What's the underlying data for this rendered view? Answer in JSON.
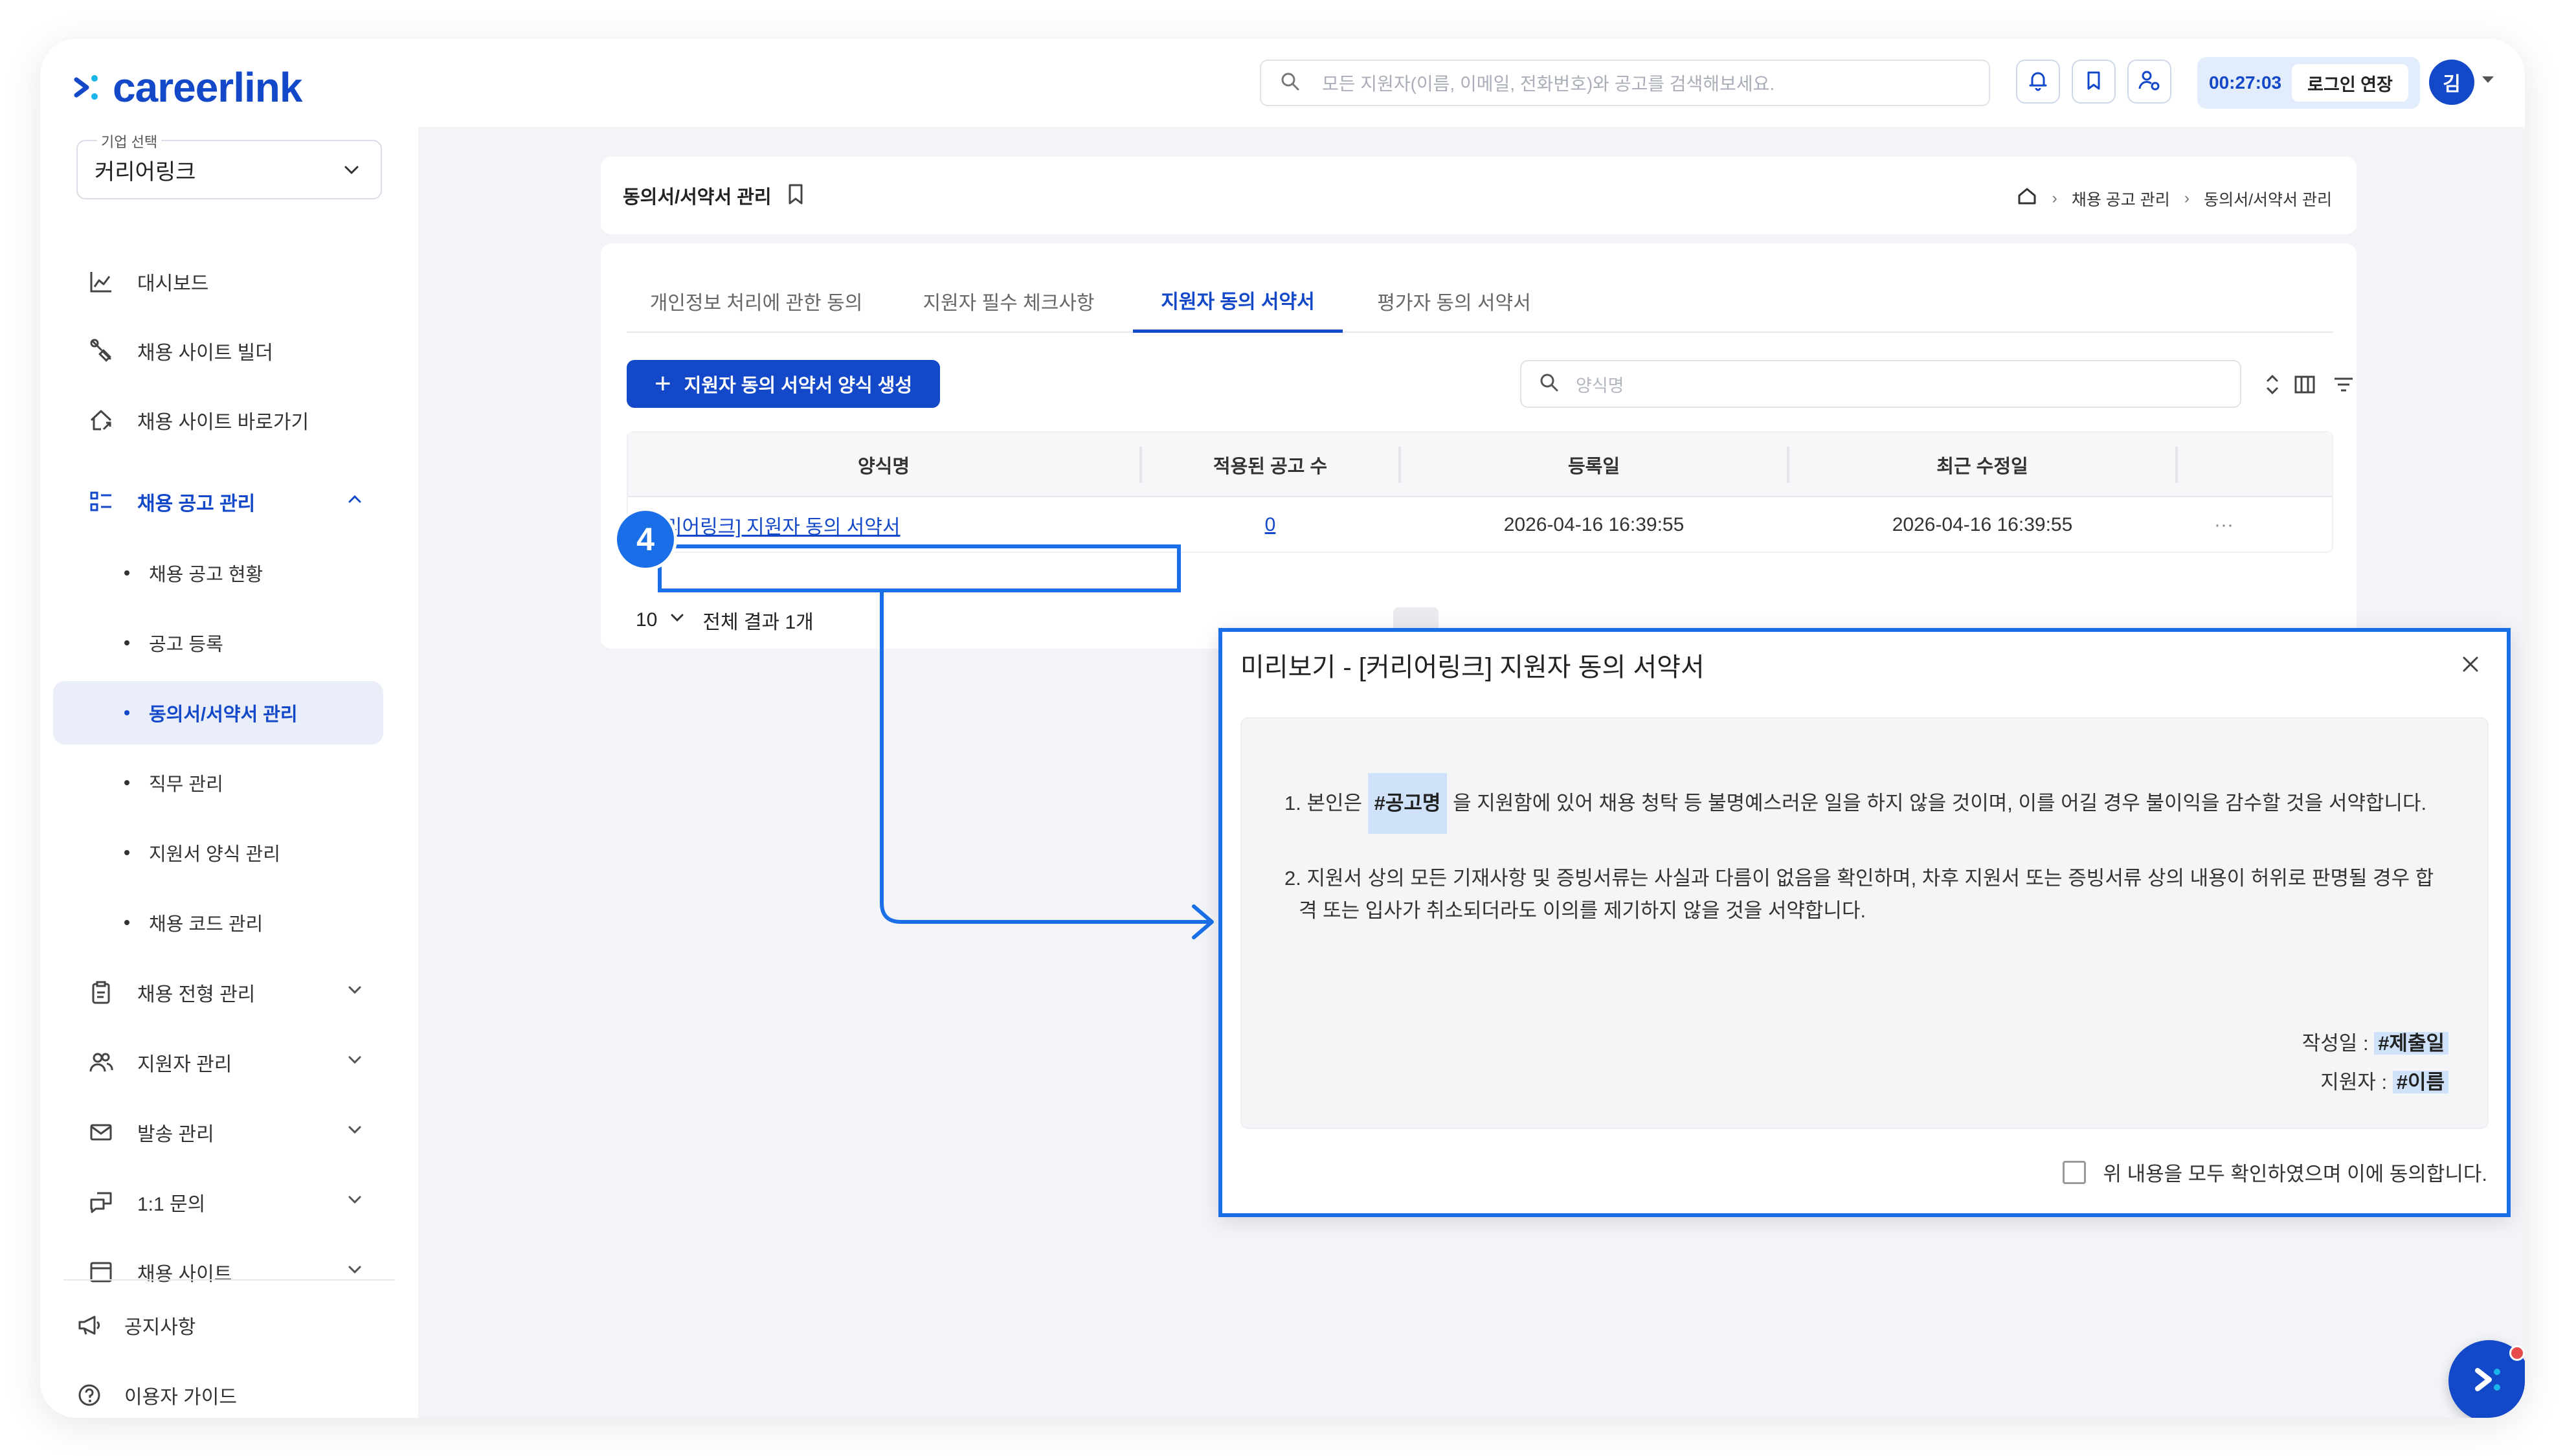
{
  "app": {
    "logo_text": "careerlink",
    "search_placeholder": "모든 지원자(이름, 이메일, 전화번호)와 공고를 검색해보세요.",
    "timer": "00:27:03",
    "extend_login": "로그인 연장",
    "avatar_initial": "김"
  },
  "sidebar": {
    "company_label": "기업 선택",
    "company_value": "커리어링크",
    "items": [
      {
        "label": "대시보드",
        "icon": "chart-icon"
      },
      {
        "label": "채용 사이트 빌더",
        "icon": "wrench-icon"
      },
      {
        "label": "채용 사이트 바로가기",
        "icon": "home-link-icon"
      },
      {
        "label": "채용 공고 관리",
        "icon": "list-icon"
      }
    ],
    "sub_items": [
      "채용 공고 현황",
      "공고 등록",
      "동의서/서약서 관리",
      "직무 관리",
      "지원서 양식 관리",
      "채용 코드 관리"
    ],
    "more_items": [
      {
        "label": "채용 전형 관리",
        "icon": "clipboard-icon"
      },
      {
        "label": "지원자 관리",
        "icon": "users-icon"
      },
      {
        "label": "발송 관리",
        "icon": "mail-icon"
      },
      {
        "label": "1:1 문의",
        "icon": "chat-icon"
      },
      {
        "label": "채용 사이트",
        "icon": "window-icon"
      }
    ],
    "bottom_items": [
      {
        "label": "공지사항",
        "icon": "megaphone-icon"
      },
      {
        "label": "이용자 가이드",
        "icon": "help-icon"
      }
    ]
  },
  "page": {
    "title": "동의서/서약서 관리",
    "breadcrumb": [
      "채용 공고 관리",
      "동의서/서약서 관리"
    ]
  },
  "tabs": [
    "개인정보 처리에 관한 동의",
    "지원자 필수 체크사항",
    "지원자 동의 서약서",
    "평가자 동의 서약서"
  ],
  "toolbar": {
    "create_label": "지원자 동의 서약서 양식 생성",
    "search_placeholder": "양식명"
  },
  "table": {
    "columns": [
      "양식명",
      "적용된 공고 수",
      "등록일",
      "최근 수정일"
    ],
    "rows": [
      {
        "name": "[커리어링크] 지원자 동의 서약서",
        "count": "0",
        "created": "2026-04-16 16:39:55",
        "updated": "2026-04-16 16:39:55",
        "more": "···"
      }
    ]
  },
  "pagination": {
    "page_size": "10",
    "total": "전체 결과 1개"
  },
  "annotation": {
    "step": "4"
  },
  "modal": {
    "title": "미리보기 - [커리어링크] 지원자 동의 서약서",
    "clause1_prefix": "1. 본인은",
    "clause1_tag": "#공고명",
    "clause1_suffix": "을 지원함에 있어 채용 청탁 등 불명예스러운 일을 하지 않을 것이며, 이를 어길 경우 불이익을 감수할 것을 서약합니다.",
    "clause2_line1": "2. 지원서 상의 모든 기재사항 및 증빙서류는 사실과 다름이 없음을 확인하며, 차후 지원서 또는 증빙서류 상의 내용이 허위로 판명될 경우 합",
    "clause2_line2": "격 또는 입사가 취소되더라도 이의를 제기하지 않을 것을 서약합니다.",
    "date_label": "작성일 :",
    "date_tag": "#제출일",
    "applicant_label": "지원자 :",
    "applicant_tag": "#이름",
    "agree_text": "위 내용을 모두 확인하였으며 이에 동의합니다."
  },
  "colors": {
    "brand": "#1348c9",
    "annotation": "#1a6fe8",
    "tag_bg": "#cfe2fa"
  }
}
